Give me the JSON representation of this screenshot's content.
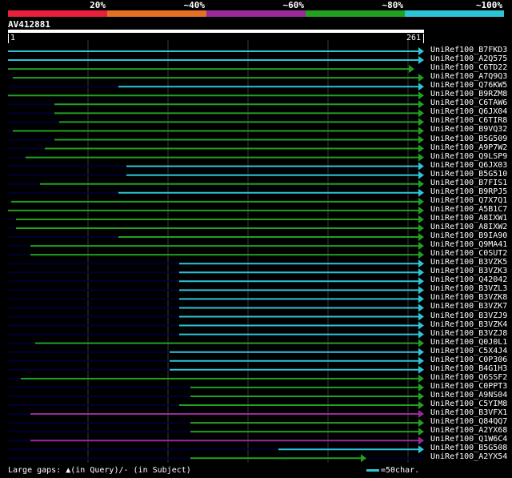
{
  "legend": {
    "segments": [
      {
        "label": "20%",
        "color": "#e8203c"
      },
      {
        "label": "~40%",
        "color": "#e57024"
      },
      {
        "label": "~60%",
        "color": "#9a2a9a"
      },
      {
        "label": "~80%",
        "color": "#22a020"
      },
      {
        "label": "~100%",
        "color": "#2ec4d6"
      }
    ]
  },
  "query": {
    "name": "AV412881",
    "start_label": "1",
    "end_label": "261",
    "length": 261
  },
  "colors": {
    "cyan": "#2ec4d6",
    "green": "#22a020",
    "purple": "#9a2a9a",
    "navy": "#000033",
    "grid": "#3a3a3a"
  },
  "hits": [
    {
      "name": "UniRef100_B7FKD3",
      "start": 1,
      "end": 261,
      "color": "cyan"
    },
    {
      "name": "UniRef100_A2Q575",
      "start": 1,
      "end": 261,
      "color": "cyan"
    },
    {
      "name": "UniRef100_C6TD22",
      "start": 1,
      "end": 255,
      "color": "green"
    },
    {
      "name": "UniRef100_A7Q9Q3",
      "start": 4,
      "end": 261,
      "color": "green"
    },
    {
      "name": "UniRef100_Q76KW5",
      "start": 70,
      "end": 261,
      "color": "cyan"
    },
    {
      "name": "UniRef100_B9RZM8",
      "start": 1,
      "end": 261,
      "color": "green"
    },
    {
      "name": "UniRef100_C6TAW6",
      "start": 30,
      "end": 261,
      "color": "green"
    },
    {
      "name": "UniRef100_Q6JX04",
      "start": 30,
      "end": 261,
      "color": "green"
    },
    {
      "name": "UniRef100_C6TIR8",
      "start": 33,
      "end": 261,
      "color": "green"
    },
    {
      "name": "UniRef100_B9VQ32",
      "start": 4,
      "end": 261,
      "color": "green"
    },
    {
      "name": "UniRef100_B5G509",
      "start": 30,
      "end": 261,
      "color": "green"
    },
    {
      "name": "UniRef100_A9P7W2",
      "start": 24,
      "end": 261,
      "color": "green"
    },
    {
      "name": "UniRef100_Q9LSP9",
      "start": 12,
      "end": 261,
      "color": "green"
    },
    {
      "name": "UniRef100_Q6JX03",
      "start": 75,
      "end": 261,
      "color": "cyan"
    },
    {
      "name": "UniRef100_B5G510",
      "start": 75,
      "end": 261,
      "color": "cyan"
    },
    {
      "name": "UniRef100_B7FIS1",
      "start": 21,
      "end": 261,
      "color": "green"
    },
    {
      "name": "UniRef100_B9RPJ5",
      "start": 70,
      "end": 261,
      "color": "cyan"
    },
    {
      "name": "UniRef100_Q7X7Q1",
      "start": 3,
      "end": 261,
      "color": "green"
    },
    {
      "name": "UniRef100_A5B1C7",
      "start": 1,
      "end": 261,
      "color": "green"
    },
    {
      "name": "UniRef100_A8IXW1",
      "start": 6,
      "end": 261,
      "color": "green"
    },
    {
      "name": "UniRef100_A8IXW2",
      "start": 6,
      "end": 261,
      "color": "green"
    },
    {
      "name": "UniRef100_B9IA90",
      "start": 70,
      "end": 261,
      "color": "green"
    },
    {
      "name": "UniRef100_Q9MA41",
      "start": 15,
      "end": 261,
      "color": "green"
    },
    {
      "name": "UniRef100_C0SUT2",
      "start": 15,
      "end": 261,
      "color": "green"
    },
    {
      "name": "UniRef100_B3VZK5",
      "start": 108,
      "end": 261,
      "color": "cyan"
    },
    {
      "name": "UniRef100_B3VZK3",
      "start": 108,
      "end": 261,
      "color": "cyan"
    },
    {
      "name": "UniRef100_Q42042",
      "start": 108,
      "end": 261,
      "color": "cyan"
    },
    {
      "name": "UniRef100_B3VZL3",
      "start": 108,
      "end": 261,
      "color": "cyan"
    },
    {
      "name": "UniRef100_B3VZK8",
      "start": 108,
      "end": 261,
      "color": "cyan"
    },
    {
      "name": "UniRef100_B3VZK7",
      "start": 108,
      "end": 261,
      "color": "cyan"
    },
    {
      "name": "UniRef100_B3VZJ9",
      "start": 108,
      "end": 261,
      "color": "cyan"
    },
    {
      "name": "UniRef100_B3VZK4",
      "start": 108,
      "end": 261,
      "color": "cyan"
    },
    {
      "name": "UniRef100_B3VZJ8",
      "start": 108,
      "end": 261,
      "color": "cyan"
    },
    {
      "name": "UniRef100_Q0J0L1",
      "start": 18,
      "end": 261,
      "color": "green"
    },
    {
      "name": "UniRef100_C5X4J4",
      "start": 102,
      "end": 261,
      "color": "cyan"
    },
    {
      "name": "UniRef100_C0P306",
      "start": 102,
      "end": 261,
      "color": "cyan"
    },
    {
      "name": "UniRef100_B4G1H3",
      "start": 102,
      "end": 261,
      "color": "cyan"
    },
    {
      "name": "UniRef100_Q6SSF2",
      "start": 9,
      "end": 261,
      "color": "green"
    },
    {
      "name": "UniRef100_C0PPT3",
      "start": 115,
      "end": 261,
      "color": "green"
    },
    {
      "name": "UniRef100_A9NS04",
      "start": 115,
      "end": 261,
      "color": "green"
    },
    {
      "name": "UniRef100_C5YIM8",
      "start": 108,
      "end": 261,
      "color": "green"
    },
    {
      "name": "UniRef100_B3VFX1",
      "start": 15,
      "end": 261,
      "color": "purple"
    },
    {
      "name": "UniRef100_Q84QQ7",
      "start": 115,
      "end": 261,
      "color": "green"
    },
    {
      "name": "UniRef100_A2YX68",
      "start": 115,
      "end": 261,
      "color": "green"
    },
    {
      "name": "UniRef100_Q1W6C4",
      "start": 15,
      "end": 261,
      "color": "purple"
    },
    {
      "name": "UniRef100_B5G508",
      "start": 170,
      "end": 261,
      "color": "cyan"
    },
    {
      "name": "UniRef100_A2YX54",
      "start": 115,
      "end": 225,
      "color": "green"
    }
  ],
  "footer": {
    "large_gaps_label": "Large gaps: ▲(in Query)/- (in Subject)",
    "scale_label": "=50char."
  }
}
